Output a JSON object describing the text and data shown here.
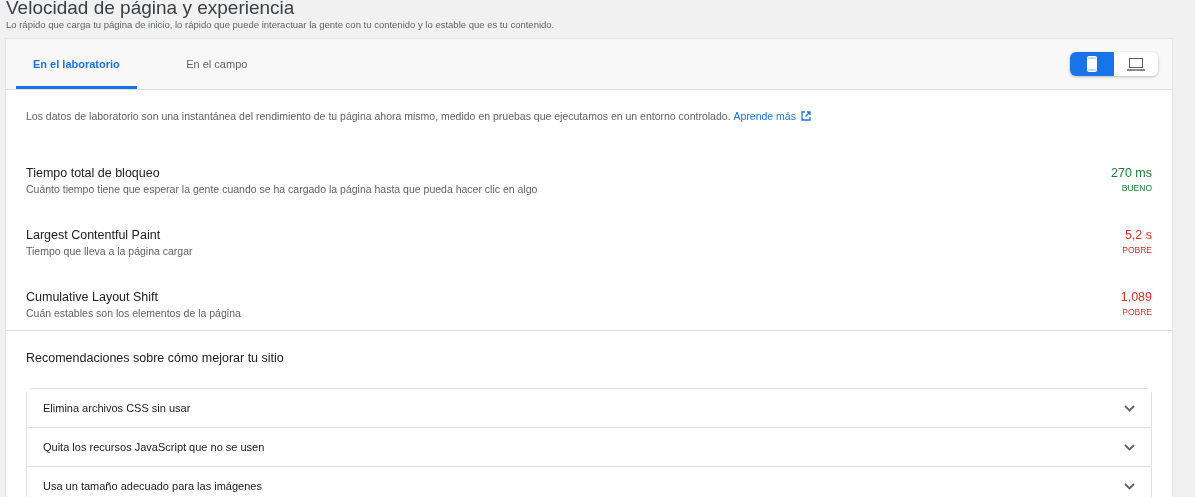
{
  "page": {
    "title": "Velocidad de página y experiencia",
    "subtitle": "Lo rápido que carga tu página de inicio, lo rápido que puede interactuar la gente con tu contenido y lo estable que es tu contenido."
  },
  "tabs": [
    {
      "label": "En el laboratorio",
      "selected": true
    },
    {
      "label": "En el campo",
      "selected": false
    }
  ],
  "devices": [
    {
      "kind": "mobile",
      "selected": true
    },
    {
      "kind": "desktop",
      "selected": false
    }
  ],
  "intro": {
    "text": "Los datos de laboratorio son una instantánea del rendimiento de tu página ahora mismo, medido en pruebas que ejecutamos en un entorno controlado.",
    "link": "Aprende más"
  },
  "metrics": [
    {
      "name": "Tiempo total de bloqueo",
      "description": "Cuánto tiempo tiene que esperar la gente cuando se ha cargado la página hasta que pueda hacer clic en algo",
      "value": "270 ms",
      "rating": "BUENO",
      "kind": "good"
    },
    {
      "name": "Largest Contentful Paint",
      "description": "Tiempo que lleva a la página cargar",
      "value": "5,2 s",
      "rating": "POBRE",
      "kind": "poor"
    },
    {
      "name": "Cumulative Layout Shift",
      "description": "Cuán estables son los elementos de la página",
      "value": "1,089",
      "rating": "POBRE",
      "kind": "poor"
    }
  ],
  "recommendations": {
    "title": "Recomendaciones sobre cómo mejorar tu sitio",
    "items": [
      {
        "label": "Elimina archivos CSS sin usar",
        "expanded": false
      },
      {
        "label": "Quita los recursos JavaScript que no se usen",
        "expanded": false
      },
      {
        "label": "Usa un tamaño adecuado para las imágenes",
        "expanded": false
      }
    ]
  }
}
